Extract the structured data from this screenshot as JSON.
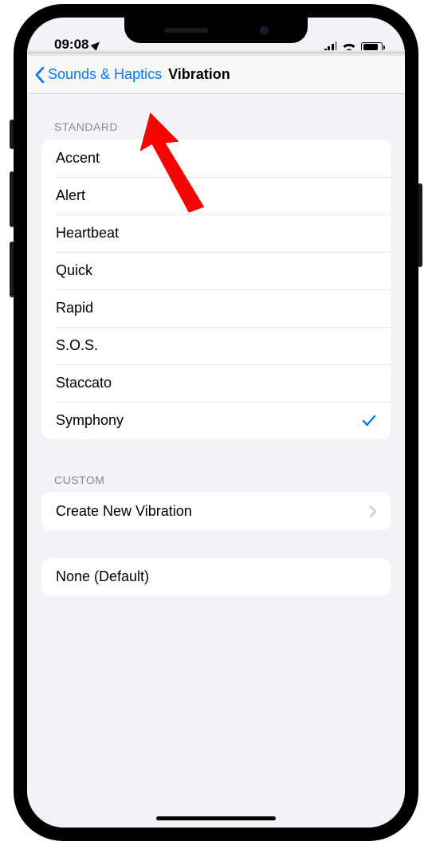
{
  "status": {
    "time": "09:08"
  },
  "nav": {
    "back_label": "Sounds & Haptics",
    "title": "Vibration"
  },
  "standard": {
    "header": "STANDARD",
    "items": [
      "Accent",
      "Alert",
      "Heartbeat",
      "Quick",
      "Rapid",
      "S.O.S.",
      "Staccato",
      "Symphony"
    ],
    "selected": "Symphony"
  },
  "custom": {
    "header": "CUSTOM",
    "create_label": "Create New Vibration"
  },
  "none": {
    "label": "None (Default)"
  }
}
